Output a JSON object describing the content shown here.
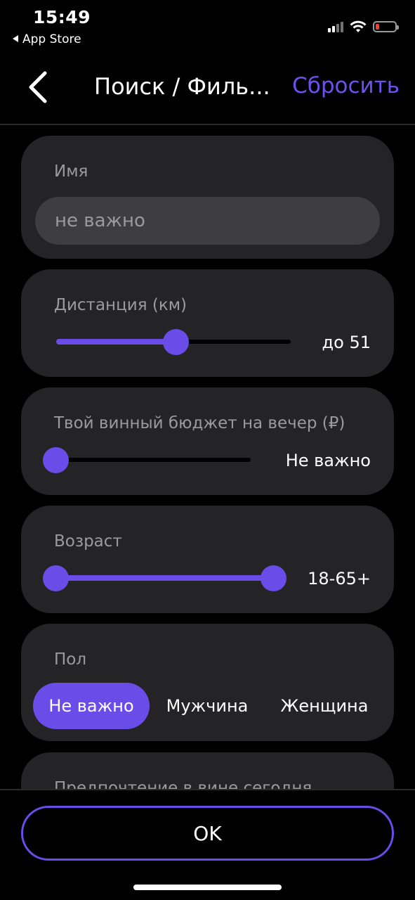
{
  "status_bar": {
    "time": "15:49",
    "back_app": "App Store",
    "battery_color": "#ff3b30"
  },
  "navbar": {
    "back_icon": "chevron-left-icon",
    "title": "Поиск / Филь...",
    "reset_label": "Сбросить",
    "accent_color": "#6a52f0"
  },
  "filters": {
    "name": {
      "label": "Имя",
      "placeholder": "не важно",
      "value": ""
    },
    "distance": {
      "label": "Дистанция (км)",
      "value_text": "до 51",
      "value": 51,
      "fill_fraction": 0.51
    },
    "budget": {
      "label": "Твой винный бюджет на вечер (₽)",
      "value_text": "Не важно",
      "fill_fraction": 0.0
    },
    "age": {
      "label": "Возраст",
      "value_text": "18-65+",
      "min": 18,
      "max": "65+"
    },
    "gender": {
      "label": "Пол",
      "options": [
        "Не важно",
        "Мужчина",
        "Женщина"
      ],
      "selected": "Не важно"
    },
    "wine_preference": {
      "label": "Предпочтение в вине сегодня"
    }
  },
  "bottom": {
    "ok_label": "OK"
  }
}
